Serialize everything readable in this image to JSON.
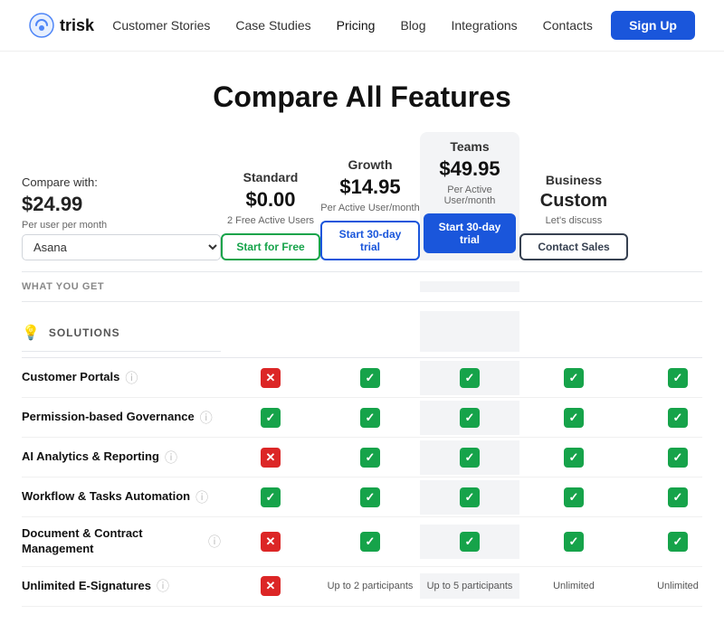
{
  "nav": {
    "logo_text": "trisk",
    "links": [
      {
        "label": "Customer Stories",
        "active": false
      },
      {
        "label": "Case Studies",
        "active": false
      },
      {
        "label": "Pricing",
        "active": true
      },
      {
        "label": "Blog",
        "active": false
      },
      {
        "label": "Integrations",
        "active": false
      },
      {
        "label": "Contacts",
        "active": false
      }
    ],
    "signup_label": "Sign Up"
  },
  "page": {
    "title": "Compare All Features"
  },
  "compare": {
    "compare_with_label": "Compare with:",
    "compare_with_price": "$24.99",
    "compare_with_sub": "Per user per month",
    "compare_with_select": "Asana",
    "what_you_get": "WHAT YOU GET"
  },
  "plans": [
    {
      "name": "Standard",
      "price": "$0.00",
      "sub": "2 Free Active Users",
      "btn_label": "Start for Free",
      "btn_style": "outline-green",
      "highlight": false
    },
    {
      "name": "Growth",
      "price": "$14.95",
      "sub": "Per Active User/month",
      "btn_label": "Start 30-day trial",
      "btn_style": "outline-blue",
      "highlight": false
    },
    {
      "name": "Teams",
      "price": "$49.95",
      "sub": "Per Active User/month",
      "btn_label": "Start 30-day trial",
      "btn_style": "filled-blue",
      "highlight": true
    },
    {
      "name": "Business",
      "price": "Custom",
      "sub": "Let's discuss",
      "btn_label": "Contact Sales",
      "btn_style": "outline-dark",
      "highlight": false
    }
  ],
  "sections": [
    {
      "name": "SOLUTIONS",
      "icon": "💡",
      "features": [
        {
          "name": "Customer Portals",
          "cells": [
            "red",
            "green",
            "green",
            "green",
            "green"
          ]
        },
        {
          "name": "Permission-based Governance",
          "cells": [
            "green",
            "green",
            "green",
            "green",
            "green"
          ]
        },
        {
          "name": "AI Analytics & Reporting",
          "cells": [
            "red",
            "green",
            "green",
            "green",
            "green"
          ]
        },
        {
          "name": "Workflow & Tasks Automation",
          "cells": [
            "green",
            "green",
            "green",
            "green",
            "green"
          ]
        },
        {
          "name": "Document & Contract Management",
          "cells": [
            "red",
            "green",
            "green",
            "green",
            "green"
          ]
        },
        {
          "name": "Unlimited E-Signatures",
          "cells": [
            "red",
            "up2",
            "up5",
            "unlimited",
            "unlimited"
          ]
        }
      ]
    }
  ],
  "cell_labels": {
    "up2": "Up to 2 participants",
    "up5": "Up to 5 participants",
    "unlimited": "Unlimited"
  }
}
